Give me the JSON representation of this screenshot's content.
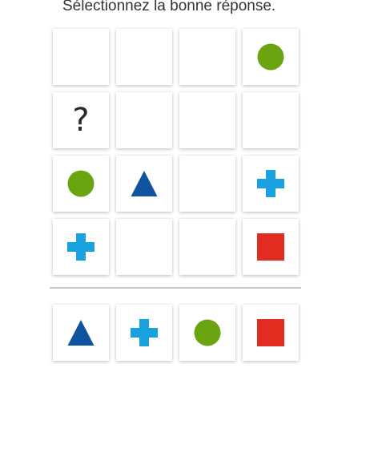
{
  "instruction": "Sélectionnez la bonne réponse.",
  "colors": {
    "circle": "#6aa511",
    "triangle": "#0e549e",
    "cross": "#1aa1e0",
    "square": "#e32d21",
    "question": "#2a2a2a"
  },
  "puzzle_grid": [
    [
      "empty",
      "empty",
      "empty",
      "circle-icon"
    ],
    [
      "question-mark",
      "empty",
      "empty",
      "empty"
    ],
    [
      "circle-icon",
      "triangle-icon",
      "empty",
      "cross-icon"
    ],
    [
      "cross-icon",
      "empty",
      "empty",
      "square-icon"
    ]
  ],
  "question_mark": "?",
  "answer_options": [
    "triangle-icon",
    "cross-icon",
    "circle-icon",
    "square-icon"
  ]
}
